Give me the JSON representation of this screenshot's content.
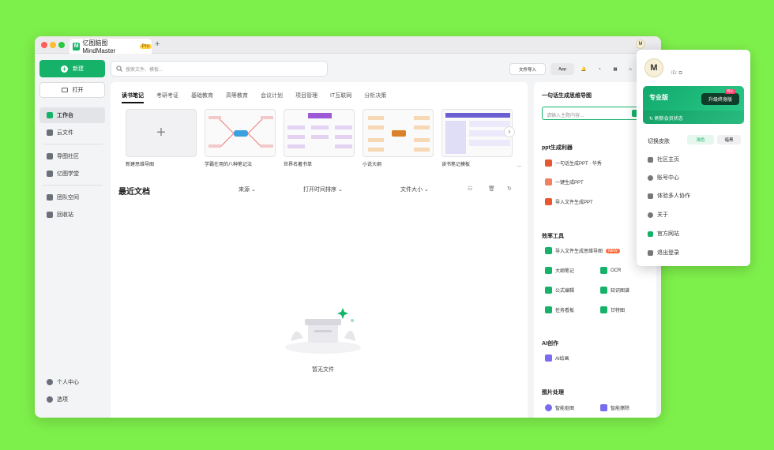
{
  "window": {
    "tab_title": "亿图脑图MindMaster",
    "tab_badge": "Pro",
    "avatar_letter": "M"
  },
  "sidebar": {
    "new_label": "新建",
    "open_label": "打开",
    "items": [
      {
        "label": "工作台"
      },
      {
        "label": "云文件"
      },
      {
        "label": "导图社区"
      },
      {
        "label": "亿图学堂"
      },
      {
        "label": "团队空间"
      },
      {
        "label": "回收站"
      }
    ],
    "bottom": [
      {
        "label": "个人中心"
      },
      {
        "label": "选项"
      }
    ]
  },
  "search": {
    "placeholder": "搜索文件、模板..."
  },
  "toolbar": {
    "import_label": "文件导入",
    "app_label": "App"
  },
  "main": {
    "tabs": [
      "读书笔记",
      "考研考证",
      "基础教育",
      "高等教育",
      "会议计划",
      "项目管理",
      "IT互联网",
      "分析决策"
    ],
    "templates": [
      {
        "caption": "新建思维导图"
      },
      {
        "caption": "学霸在用的八种笔记法"
      },
      {
        "caption": "世界名著书单"
      },
      {
        "caption": "小说大纲"
      },
      {
        "caption": "读书笔记模板"
      },
      {
        "caption": "..."
      }
    ],
    "recent_title": "最近文档",
    "col_source": "来源",
    "col_sort": "打开时间排序",
    "col_size": "文件大小",
    "empty_text": "暂无文件"
  },
  "right": {
    "gen_title": "一句话生成思维导图",
    "gen_placeholder": "请输入主题内容...",
    "ppt_title": "ppt生成利器",
    "ppt_items": [
      "一句话生成PPT · 华秀",
      "一键生成PPT",
      "导入文件生成PPT"
    ],
    "eff_title": "效率工具",
    "eff_import": "导入文件生成思维导图",
    "eff_new": "NEW",
    "eff_grid": [
      "大纲笔记",
      "OCR",
      "公式编辑",
      "知识图谱",
      "任务看板",
      "甘特图"
    ],
    "ai_title": "AI创作",
    "ai_items": [
      "AI绘画"
    ],
    "img_title": "图片处理",
    "img_items": [
      "智能抠图",
      "智能擦除"
    ]
  },
  "popup": {
    "avatar_letter": "M",
    "id_label": "ID:",
    "plan": "专业版",
    "upgrade": "升级终身版",
    "upgrade_badge": "特价",
    "refresh": "刷新会员状态",
    "skin_label": "切换皮肤",
    "skin_light": "浅色",
    "skin_dark": "暗黑",
    "items": [
      "社区主页",
      "账号中心",
      "体验多人协作",
      "关于",
      "官方网站",
      "退出登录"
    ]
  },
  "colors": {
    "brand": "#17b26a",
    "background": "#7ef04b"
  }
}
